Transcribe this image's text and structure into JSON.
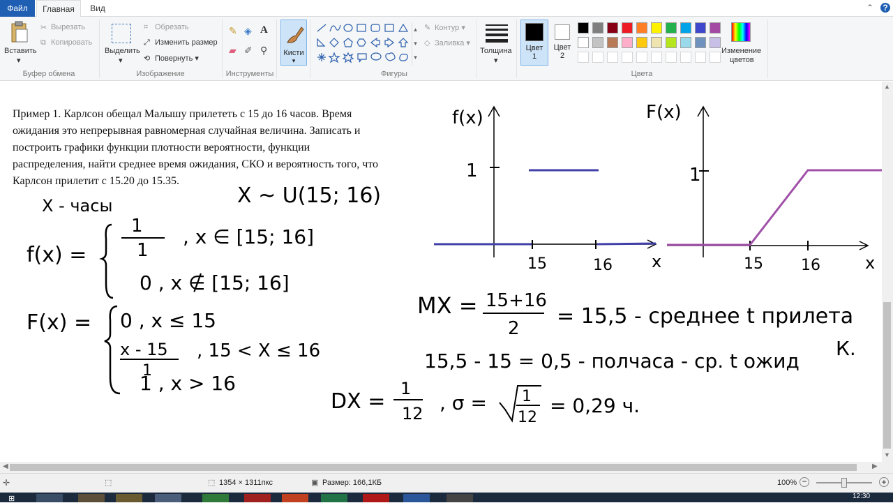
{
  "tabs": {
    "file": "Файл",
    "home": "Главная",
    "view": "Вид"
  },
  "ribbon": {
    "clipboard": {
      "paste": "Вставить",
      "cut": "Вырезать",
      "copy": "Копировать",
      "label": "Буфер обмена"
    },
    "image": {
      "select": "Выделить",
      "crop": "Обрезать",
      "resize": "Изменить размер",
      "rotate": "Повернуть",
      "label": "Изображение"
    },
    "tools": {
      "label": "Инструменты"
    },
    "brushes": {
      "label": "Кисти"
    },
    "shapes": {
      "outline": "Контур",
      "fill": "Заливка",
      "label": "Фигуры"
    },
    "size": {
      "label": "Толщина"
    },
    "colors": {
      "color1": "Цвет 1",
      "color1_a": "Цвет",
      "color1_b": "1",
      "color2_a": "Цвет",
      "color2_b": "2",
      "edit": "Изменение цветов",
      "edit_a": "Изменение",
      "edit_b": "цветов",
      "label": "Цвета",
      "palette_row1": [
        "#000000",
        "#7f7f7f",
        "#880015",
        "#ed1c24",
        "#ff7f27",
        "#fff200",
        "#22b14c",
        "#00a2e8",
        "#3f48cc",
        "#a349a4"
      ],
      "palette_row2": [
        "#ffffff",
        "#c3c3c3",
        "#b97a57",
        "#ffaec9",
        "#ffc90e",
        "#efe4b0",
        "#b5e61d",
        "#99d9ea",
        "#7092be",
        "#c8bfe7"
      ]
    }
  },
  "canvas": {
    "problem_text": [
      "Пример 1. Карлсон обещал Малышу прилететь с 15 до 16 часов. Время",
      "ожидания это непрерывная равномерная случайная величина. Записать и",
      "построить графики функции плотности вероятности, функции",
      "распределения, найти среднее время ожидания, СКО и вероятность того, что",
      "Карлсон прилетит с 15.20 до 15.35."
    ],
    "hw": {
      "distribution": "X ~ U(15; 16)",
      "x_def": "X - часы",
      "f_label": "f(x) =",
      "f_case1_num": "1",
      "f_case1_den": "1",
      "f_case1_cond": ", x ∈ [15; 16]",
      "f_case2": "0 ,  x ∉ [15; 16]",
      "F_label": "F(x) =",
      "F_case1": "0 ,   x ≤ 15",
      "F_case2_num": "x - 15",
      "F_case2_den": "1",
      "F_case2_cond": ", 15 < X ≤ 16",
      "F_case3": "1 ,  x > 16",
      "mx_left": "MX =",
      "mx_num": "15+16",
      "mx_den": "2",
      "mx_right": "= 15,5 - среднее t прилета",
      "mx_k": "К.",
      "wait_line": "15,5 - 15 = 0,5 - полчаса - ср. t ожид",
      "dx_left": "DX =",
      "dx_num": "1",
      "dx_den": "12",
      "sigma": ", σ =",
      "sigma_num": "1",
      "sigma_den": "12",
      "sigma_val": "= 0,29 ч.",
      "graph1_title": "f(x)",
      "graph1_y1": "1",
      "graph1_t15": "15",
      "graph1_t16": "16",
      "graph1_x": "x",
      "graph2_title": "F(x)",
      "graph2_y1": "1",
      "graph2_t15": "15",
      "graph2_t16": "16",
      "graph2_x": "x"
    }
  },
  "status": {
    "dimensions": "1354 × 1311пкс",
    "size": "Размер: 166,1КБ",
    "zoom": "100%"
  },
  "taskbar": {
    "time": "12:30"
  }
}
